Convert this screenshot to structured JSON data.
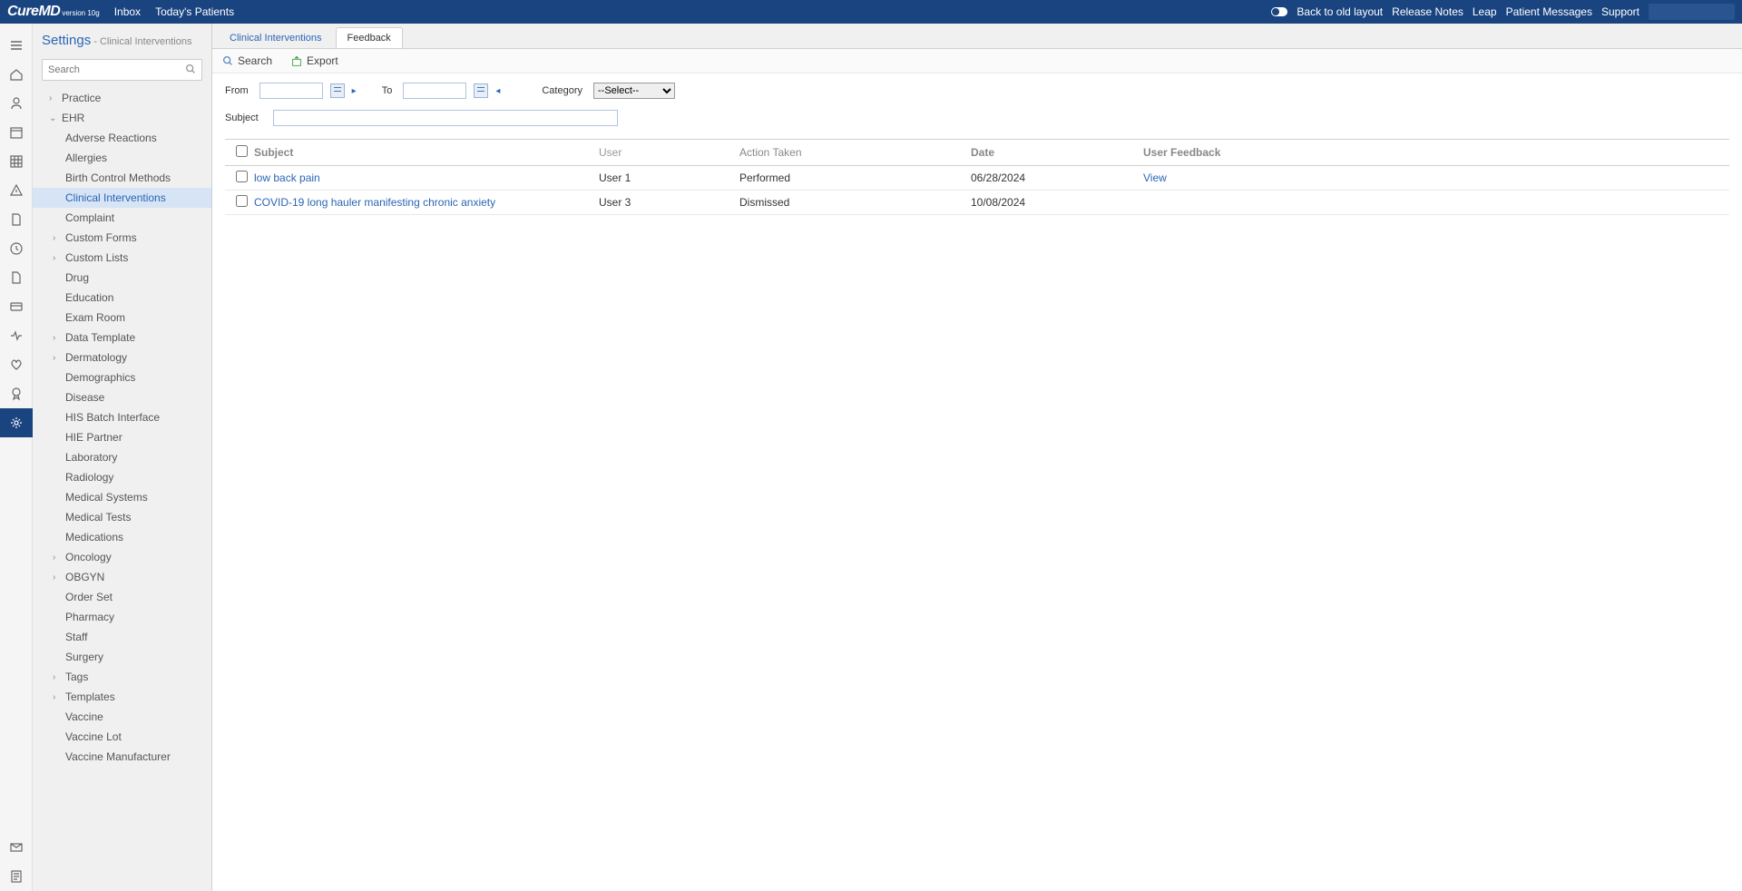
{
  "topbar": {
    "logo": "CureMD",
    "logo_sub": "version 10g",
    "links_left": [
      "Inbox",
      "Today's Patients"
    ],
    "links_right": [
      "Back to old layout",
      "Release Notes",
      "Leap",
      "Patient Messages",
      "Support"
    ]
  },
  "sidebar": {
    "title": "Settings",
    "subtitle": " - Clinical Interventions",
    "search_placeholder": "Search",
    "tree": [
      {
        "label": "Practice",
        "level": 1,
        "expandable": true,
        "expanded": false
      },
      {
        "label": "EHR",
        "level": 1,
        "expandable": true,
        "expanded": true
      },
      {
        "label": "Adverse Reactions",
        "level": 2
      },
      {
        "label": "Allergies",
        "level": 2
      },
      {
        "label": "Birth Control Methods",
        "level": 2
      },
      {
        "label": "Clinical Interventions",
        "level": 2,
        "selected": true
      },
      {
        "label": "Complaint",
        "level": 2
      },
      {
        "label": "Custom Forms",
        "level": 2,
        "expandable": true
      },
      {
        "label": "Custom Lists",
        "level": 2,
        "expandable": true
      },
      {
        "label": "Drug",
        "level": 2
      },
      {
        "label": "Education",
        "level": 2
      },
      {
        "label": "Exam Room",
        "level": 2
      },
      {
        "label": "Data Template",
        "level": 2,
        "expandable": true
      },
      {
        "label": "Dermatology",
        "level": 2,
        "expandable": true
      },
      {
        "label": "Demographics",
        "level": 2
      },
      {
        "label": "Disease",
        "level": 2
      },
      {
        "label": "HIS Batch Interface",
        "level": 2
      },
      {
        "label": "HIE Partner",
        "level": 2
      },
      {
        "label": "Laboratory",
        "level": 2
      },
      {
        "label": "Radiology",
        "level": 2
      },
      {
        "label": "Medical Systems",
        "level": 2
      },
      {
        "label": "Medical Tests",
        "level": 2
      },
      {
        "label": "Medications",
        "level": 2
      },
      {
        "label": "Oncology",
        "level": 2,
        "expandable": true
      },
      {
        "label": "OBGYN",
        "level": 2,
        "expandable": true
      },
      {
        "label": "Order Set",
        "level": 2
      },
      {
        "label": "Pharmacy",
        "level": 2
      },
      {
        "label": "Staff",
        "level": 2
      },
      {
        "label": "Surgery",
        "level": 2
      },
      {
        "label": "Tags",
        "level": 2,
        "expandable": true
      },
      {
        "label": "Templates",
        "level": 2,
        "expandable": true
      },
      {
        "label": "Vaccine",
        "level": 2
      },
      {
        "label": "Vaccine Lot",
        "level": 2
      },
      {
        "label": "Vaccine Manufacturer",
        "level": 2
      }
    ]
  },
  "tabs": {
    "items": [
      "Clinical Interventions",
      "Feedback"
    ],
    "active_index": 1
  },
  "toolbar": {
    "search_label": "Search",
    "export_label": "Export"
  },
  "filters": {
    "from_label": "From",
    "to_label": "To",
    "category_label": "Category",
    "category_selected": "--Select--",
    "subject_label": "Subject"
  },
  "grid": {
    "headers": {
      "subject": "Subject",
      "user": "User",
      "action": "Action Taken",
      "date": "Date",
      "feedback": "User Feedback"
    },
    "rows": [
      {
        "subject": "low back pain",
        "user": "User 1",
        "action": "Performed",
        "date": "06/28/2024",
        "feedback": "View"
      },
      {
        "subject": "COVID-19 long hauler manifesting chronic anxiety",
        "user": "User 3",
        "action": "Dismissed",
        "date": "10/08/2024",
        "feedback": ""
      }
    ]
  }
}
